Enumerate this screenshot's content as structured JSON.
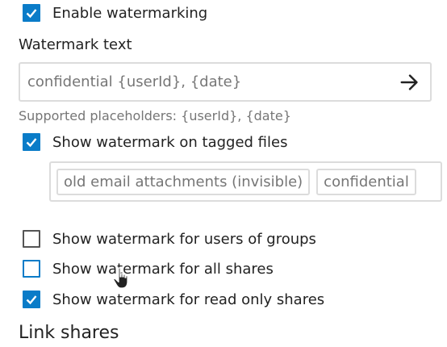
{
  "settings": {
    "enable_watermarking": {
      "label": "Enable watermarking",
      "checked": true
    },
    "watermark_text": {
      "heading": "Watermark text",
      "value": "confidential {userId}, {date}",
      "submit_icon": "arrow-right-icon",
      "hint": "Supported placeholders: {userId}, {date}"
    },
    "tagged_files": {
      "label": "Show watermark on tagged files",
      "checked": true,
      "tags": [
        "old email attachments (invisible)",
        "confidential"
      ]
    },
    "groups": {
      "label": "Show watermark for users of groups",
      "checked": false
    },
    "all_shares": {
      "label": "Show watermark for all shares",
      "checked": false
    },
    "read_only": {
      "label": "Show watermark for read only shares",
      "checked": true
    }
  },
  "link_shares": {
    "heading": "Link shares"
  },
  "colors": {
    "accent": "#0a7cc8",
    "border": "#dcdcdc",
    "muted": "#767676"
  },
  "cursor": "hand-pointer-icon"
}
